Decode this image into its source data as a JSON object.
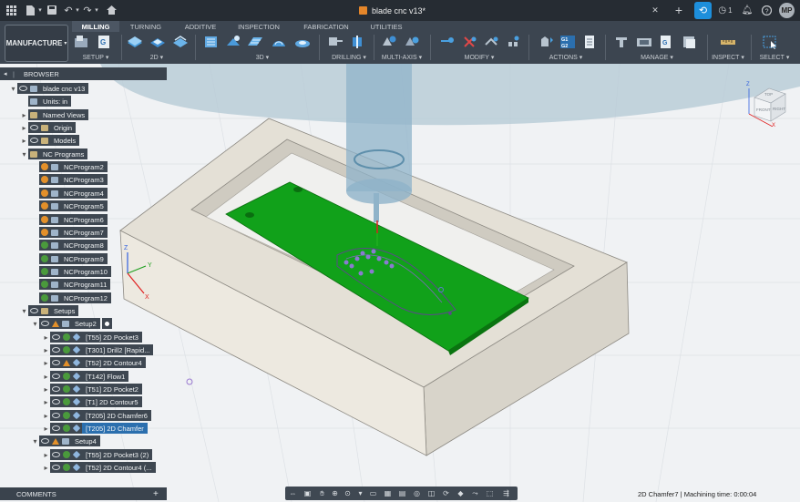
{
  "title_bar": {
    "document_title": "blade cnc v13*",
    "notifications_count": "1",
    "user_initials": "MP",
    "icons": [
      "grid-icon",
      "file-icon",
      "save-icon",
      "undo-icon",
      "redo-icon",
      "home-icon",
      "plus-icon",
      "clock-icon",
      "bell-icon",
      "help-icon"
    ]
  },
  "ribbon": {
    "workspace": "MANUFACTURE",
    "tabs": [
      "MILLING",
      "TURNING",
      "ADDITIVE",
      "INSPECTION",
      "FABRICATION",
      "UTILITIES"
    ],
    "active_tab": "MILLING",
    "groups": [
      "SETUP",
      "2D",
      "3D",
      "DRILLING",
      "MULTI-AXIS",
      "MODIFY",
      "ACTIONS",
      "MANAGE",
      "INSPECT",
      "SELECT"
    ]
  },
  "browser": {
    "header": "BROWSER",
    "root": "blade cnc v13",
    "units": "Units: in",
    "named_views": "Named Views",
    "origin": "Origin",
    "models": "Models",
    "nc_programs": "NC Programs",
    "nc_items": [
      {
        "label": "NCProgram2",
        "status": "pending"
      },
      {
        "label": "NCProgram3",
        "status": "pending"
      },
      {
        "label": "NCProgram4",
        "status": "pending"
      },
      {
        "label": "NCProgram5",
        "status": "pending"
      },
      {
        "label": "NCProgram6",
        "status": "pending"
      },
      {
        "label": "NCProgram7",
        "status": "pending"
      },
      {
        "label": "NCProgram8",
        "status": "ok"
      },
      {
        "label": "NCProgram9",
        "status": "ok"
      },
      {
        "label": "NCProgram10",
        "status": "ok"
      },
      {
        "label": "NCProgram11",
        "status": "ok"
      },
      {
        "label": "NCProgram12",
        "status": "ok"
      }
    ],
    "setups": "Setups",
    "setup2": "Setup2",
    "setup2_ops": [
      {
        "label": "[T55] 2D Pocket3",
        "status": "ok",
        "selected": false
      },
      {
        "label": "[T301] Drill2 [Rapid...",
        "status": "ok",
        "selected": false
      },
      {
        "label": "[T52] 2D Contour4",
        "status": "warn",
        "selected": false
      },
      {
        "label": "[T142] Flow1",
        "status": "ok",
        "selected": false
      },
      {
        "label": "[T51] 2D Pocket2",
        "status": "ok",
        "selected": false
      },
      {
        "label": "[T1] 2D Contour5",
        "status": "ok",
        "selected": false
      },
      {
        "label": "[T205] 2D Chamfer6",
        "status": "ok",
        "selected": false
      },
      {
        "label": "[T205] 2D Chamfer",
        "status": "ok",
        "selected": true
      }
    ],
    "setup4": "Setup4",
    "setup4_ops": [
      {
        "label": "[T55] 2D Pocket3 (2)",
        "status": "ok",
        "selected": false
      },
      {
        "label": "[T52] 2D Contour4 (...",
        "status": "ok",
        "selected": false
      }
    ]
  },
  "comments": {
    "label": "COMMENTS"
  },
  "viewcube": {
    "top": "TOP",
    "front": "FRONT",
    "right": "RIGHT",
    "x": "X",
    "y": "Y",
    "z": "Z"
  },
  "axes": {
    "x": "X",
    "y": "Y",
    "z": "Z"
  },
  "status": {
    "text": "2D Chamfer7 | Machining time: 0:00:04"
  },
  "colors": {
    "accent": "#1d8fdc",
    "ribbon": "#3c4550",
    "stock": "#e6e2d8",
    "part": "#0fa00f"
  }
}
